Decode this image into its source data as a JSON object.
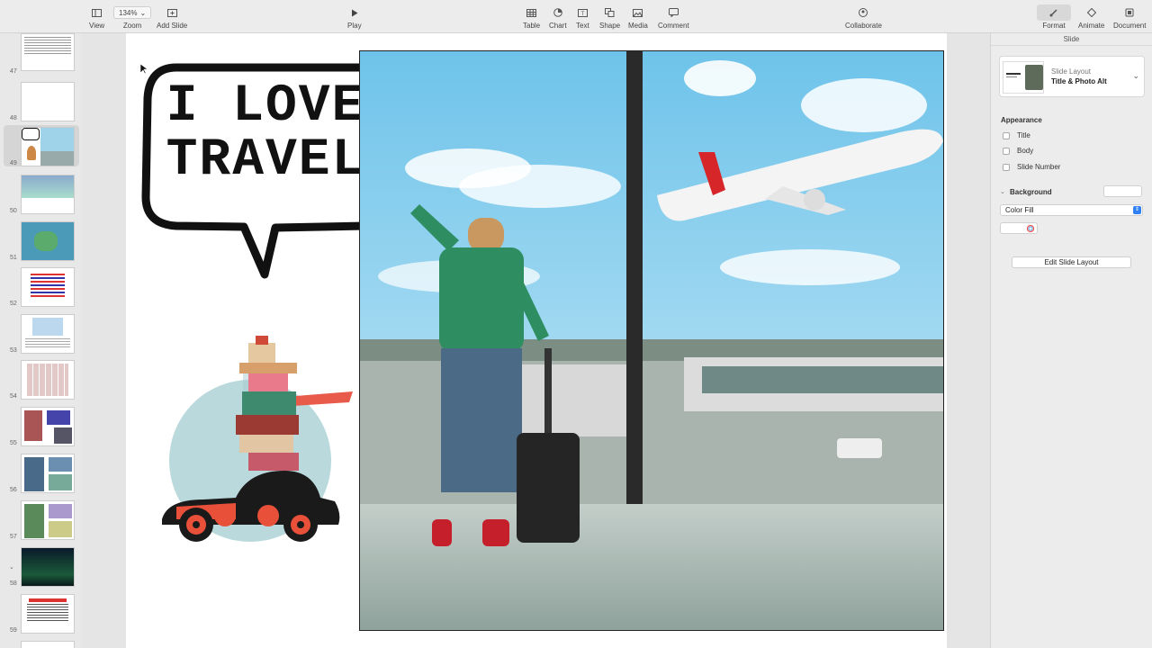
{
  "toolbar": {
    "view": "View",
    "zoom_value": "134%",
    "zoom": "Zoom",
    "add_slide": "Add Slide",
    "play": "Play",
    "table": "Table",
    "chart": "Chart",
    "text": "Text",
    "shape": "Shape",
    "media": "Media",
    "comment": "Comment",
    "collaborate": "Collaborate",
    "format": "Format",
    "animate": "Animate",
    "document": "Document"
  },
  "navigator": {
    "slides": [
      {
        "num": "47"
      },
      {
        "num": "48"
      },
      {
        "num": "49"
      },
      {
        "num": "50"
      },
      {
        "num": "51"
      },
      {
        "num": "52"
      },
      {
        "num": "53"
      },
      {
        "num": "54"
      },
      {
        "num": "55"
      },
      {
        "num": "56"
      },
      {
        "num": "57"
      },
      {
        "num": "58"
      },
      {
        "num": "59"
      }
    ],
    "selected": "49"
  },
  "slide": {
    "speech_line1": "I LOVE",
    "speech_line2": "TRAVEL"
  },
  "inspector": {
    "title": "Slide",
    "layout_caption": "Slide Layout",
    "layout_name": "Title & Photo Alt",
    "appearance": "Appearance",
    "opt_title": "Title",
    "opt_body": "Body",
    "opt_slide_number": "Slide Number",
    "background": "Background",
    "fill_type": "Color Fill",
    "edit_layout": "Edit Slide Layout"
  },
  "colors": {
    "accent_blue": "#2f7ff5",
    "sky": "#9fd3ea",
    "shirt_green": "#2e8e62",
    "car_red": "#e8503a"
  }
}
